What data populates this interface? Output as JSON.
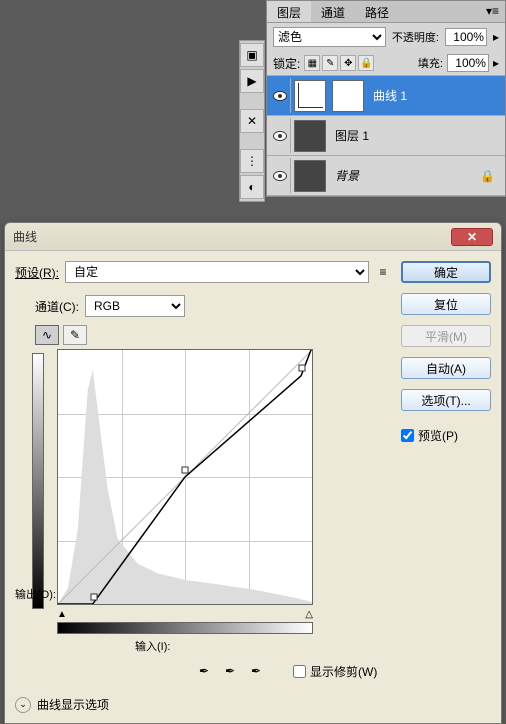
{
  "panel": {
    "tabs": {
      "layers": "图层",
      "channels": "通道",
      "paths": "路径"
    },
    "blend_mode": "滤色",
    "opacity_label": "不透明度:",
    "opacity_value": "100%",
    "lock_label": "锁定:",
    "fill_label": "填充:",
    "fill_value": "100%",
    "layers": [
      {
        "name": "曲线 1"
      },
      {
        "name": "图层 1"
      },
      {
        "name": "背景"
      }
    ]
  },
  "dialog": {
    "title": "曲线",
    "preset_label": "预设(R):",
    "preset_value": "自定",
    "channel_label": "通道(C):",
    "channel_value": "RGB",
    "output_label": "输出(O):",
    "input_label": "输入(I):",
    "clip_label": "显示修剪(W)",
    "display_opts": "曲线显示选项",
    "buttons": {
      "ok": "确定",
      "reset": "复位",
      "smooth": "平滑(M)",
      "auto": "自动(A)",
      "options": "选项(T)..."
    },
    "preview_label": "预览(P)"
  },
  "chart_data": {
    "type": "line",
    "title": "曲线",
    "xlabel": "输入",
    "ylabel": "输出",
    "xlim": [
      0,
      255
    ],
    "ylim": [
      0,
      255
    ],
    "series": [
      {
        "name": "RGB",
        "points": [
          [
            0,
            0
          ],
          [
            35,
            0
          ],
          [
            128,
            128
          ],
          [
            245,
            230
          ],
          [
            255,
            255
          ]
        ]
      }
    ],
    "histogram_note": "grayscale histogram shown behind curve with tall peak near shadows ~x=35"
  }
}
